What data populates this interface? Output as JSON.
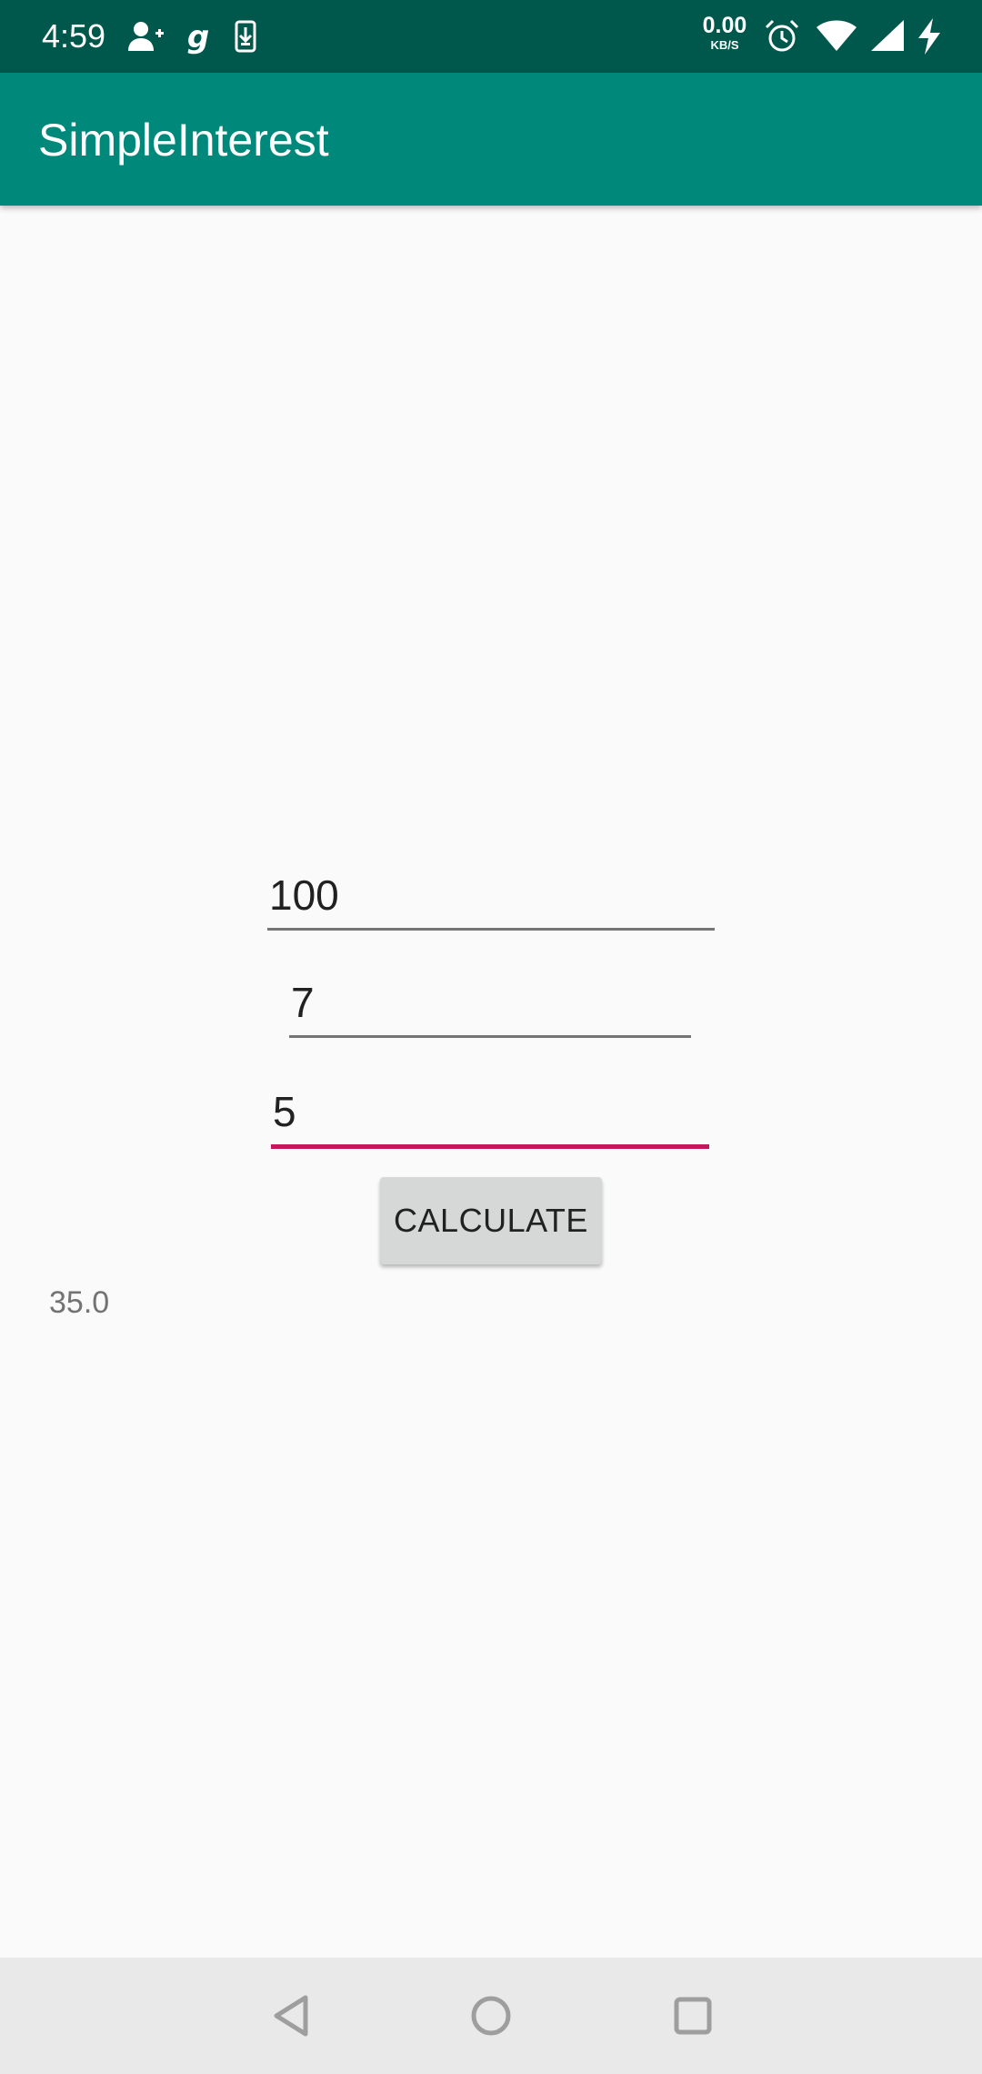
{
  "status_bar": {
    "time": "4:59",
    "net_speed_value": "0.00",
    "net_speed_unit": "KB/S",
    "icons": [
      "add-person-icon",
      "g-app-icon",
      "download-icon",
      "alarm-icon",
      "wifi-icon",
      "signal-icon",
      "charging-icon"
    ]
  },
  "app_bar": {
    "title": "SimpleInterest"
  },
  "form": {
    "principal_value": "100",
    "rate_value": "7",
    "time_value": "5",
    "calculate_label": "CALCULATE",
    "result": "35.0"
  },
  "colors": {
    "status_bar": "#00574B",
    "app_bar": "#00897B",
    "accent": "#C2185B",
    "background": "#FAFAFA",
    "nav_bar": "#E9E9E9"
  },
  "nav_bar": {
    "buttons": [
      "back-icon",
      "home-icon",
      "recents-icon"
    ]
  }
}
